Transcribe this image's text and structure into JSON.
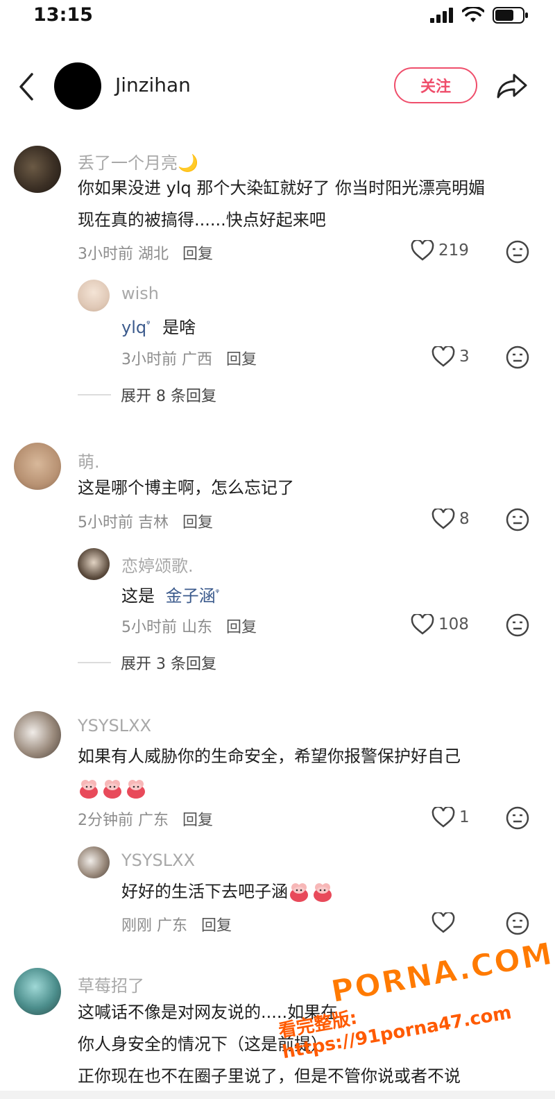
{
  "status_bar": {
    "time": "13:15"
  },
  "header": {
    "username": "Jinzihan",
    "follow_label": "关注"
  },
  "comments": [
    {
      "user": "丢了一个月亮",
      "moon": "🌙",
      "text_line1": "你如果没进 ylq 那个大染缸就好了 你当时阳光漂亮明媚",
      "text_line2": "现在真的被搞得......快点好起来吧",
      "time": "3小时前 湖北",
      "reply_label": "回复",
      "likes": "219",
      "replies": [
        {
          "user": "wish",
          "mention": "ylq",
          "text": "是啥",
          "time": "3小时前 广西",
          "reply_label": "回复",
          "likes": "3"
        }
      ],
      "expand": "展开 8 条回复"
    },
    {
      "user": "萌.",
      "text_line1": "这是哪个博主啊，怎么忘记了",
      "time": "5小时前 吉林",
      "reply_label": "回复",
      "likes": "8",
      "replies": [
        {
          "user": "恋婷颂歌.",
          "prefix": "这是",
          "mention": "金子涵",
          "time": "5小时前 山东",
          "reply_label": "回复",
          "likes": "108"
        }
      ],
      "expand": "展开 3 条回复"
    },
    {
      "user": "YSYSLXX",
      "text_line1": "如果有人威胁你的生命安全，希望你报警保护好自己",
      "time": "2分钟前 广东",
      "reply_label": "回复",
      "likes": "1",
      "replies": [
        {
          "user": "YSYSLXX",
          "text": "好好的生活下去吧子涵",
          "time": "刚刚 广东",
          "reply_label": "回复",
          "likes": ""
        }
      ]
    },
    {
      "user": "草莓招了",
      "text_line1": "这喊话不像是对网友说的.....如果在",
      "text_line2": "你人身安全的情况下（这是前提）",
      "text_line3": "正你现在也不在圈子里说了，但是不管你说或者不说"
    }
  ],
  "watermark": {
    "big": "PORNA.COM",
    "small": "看完整版: https://91porna47.com"
  },
  "colors": {
    "accent": "#ef4e6b",
    "mention": "#3b5a8c",
    "muted": "#a8a8a8"
  }
}
